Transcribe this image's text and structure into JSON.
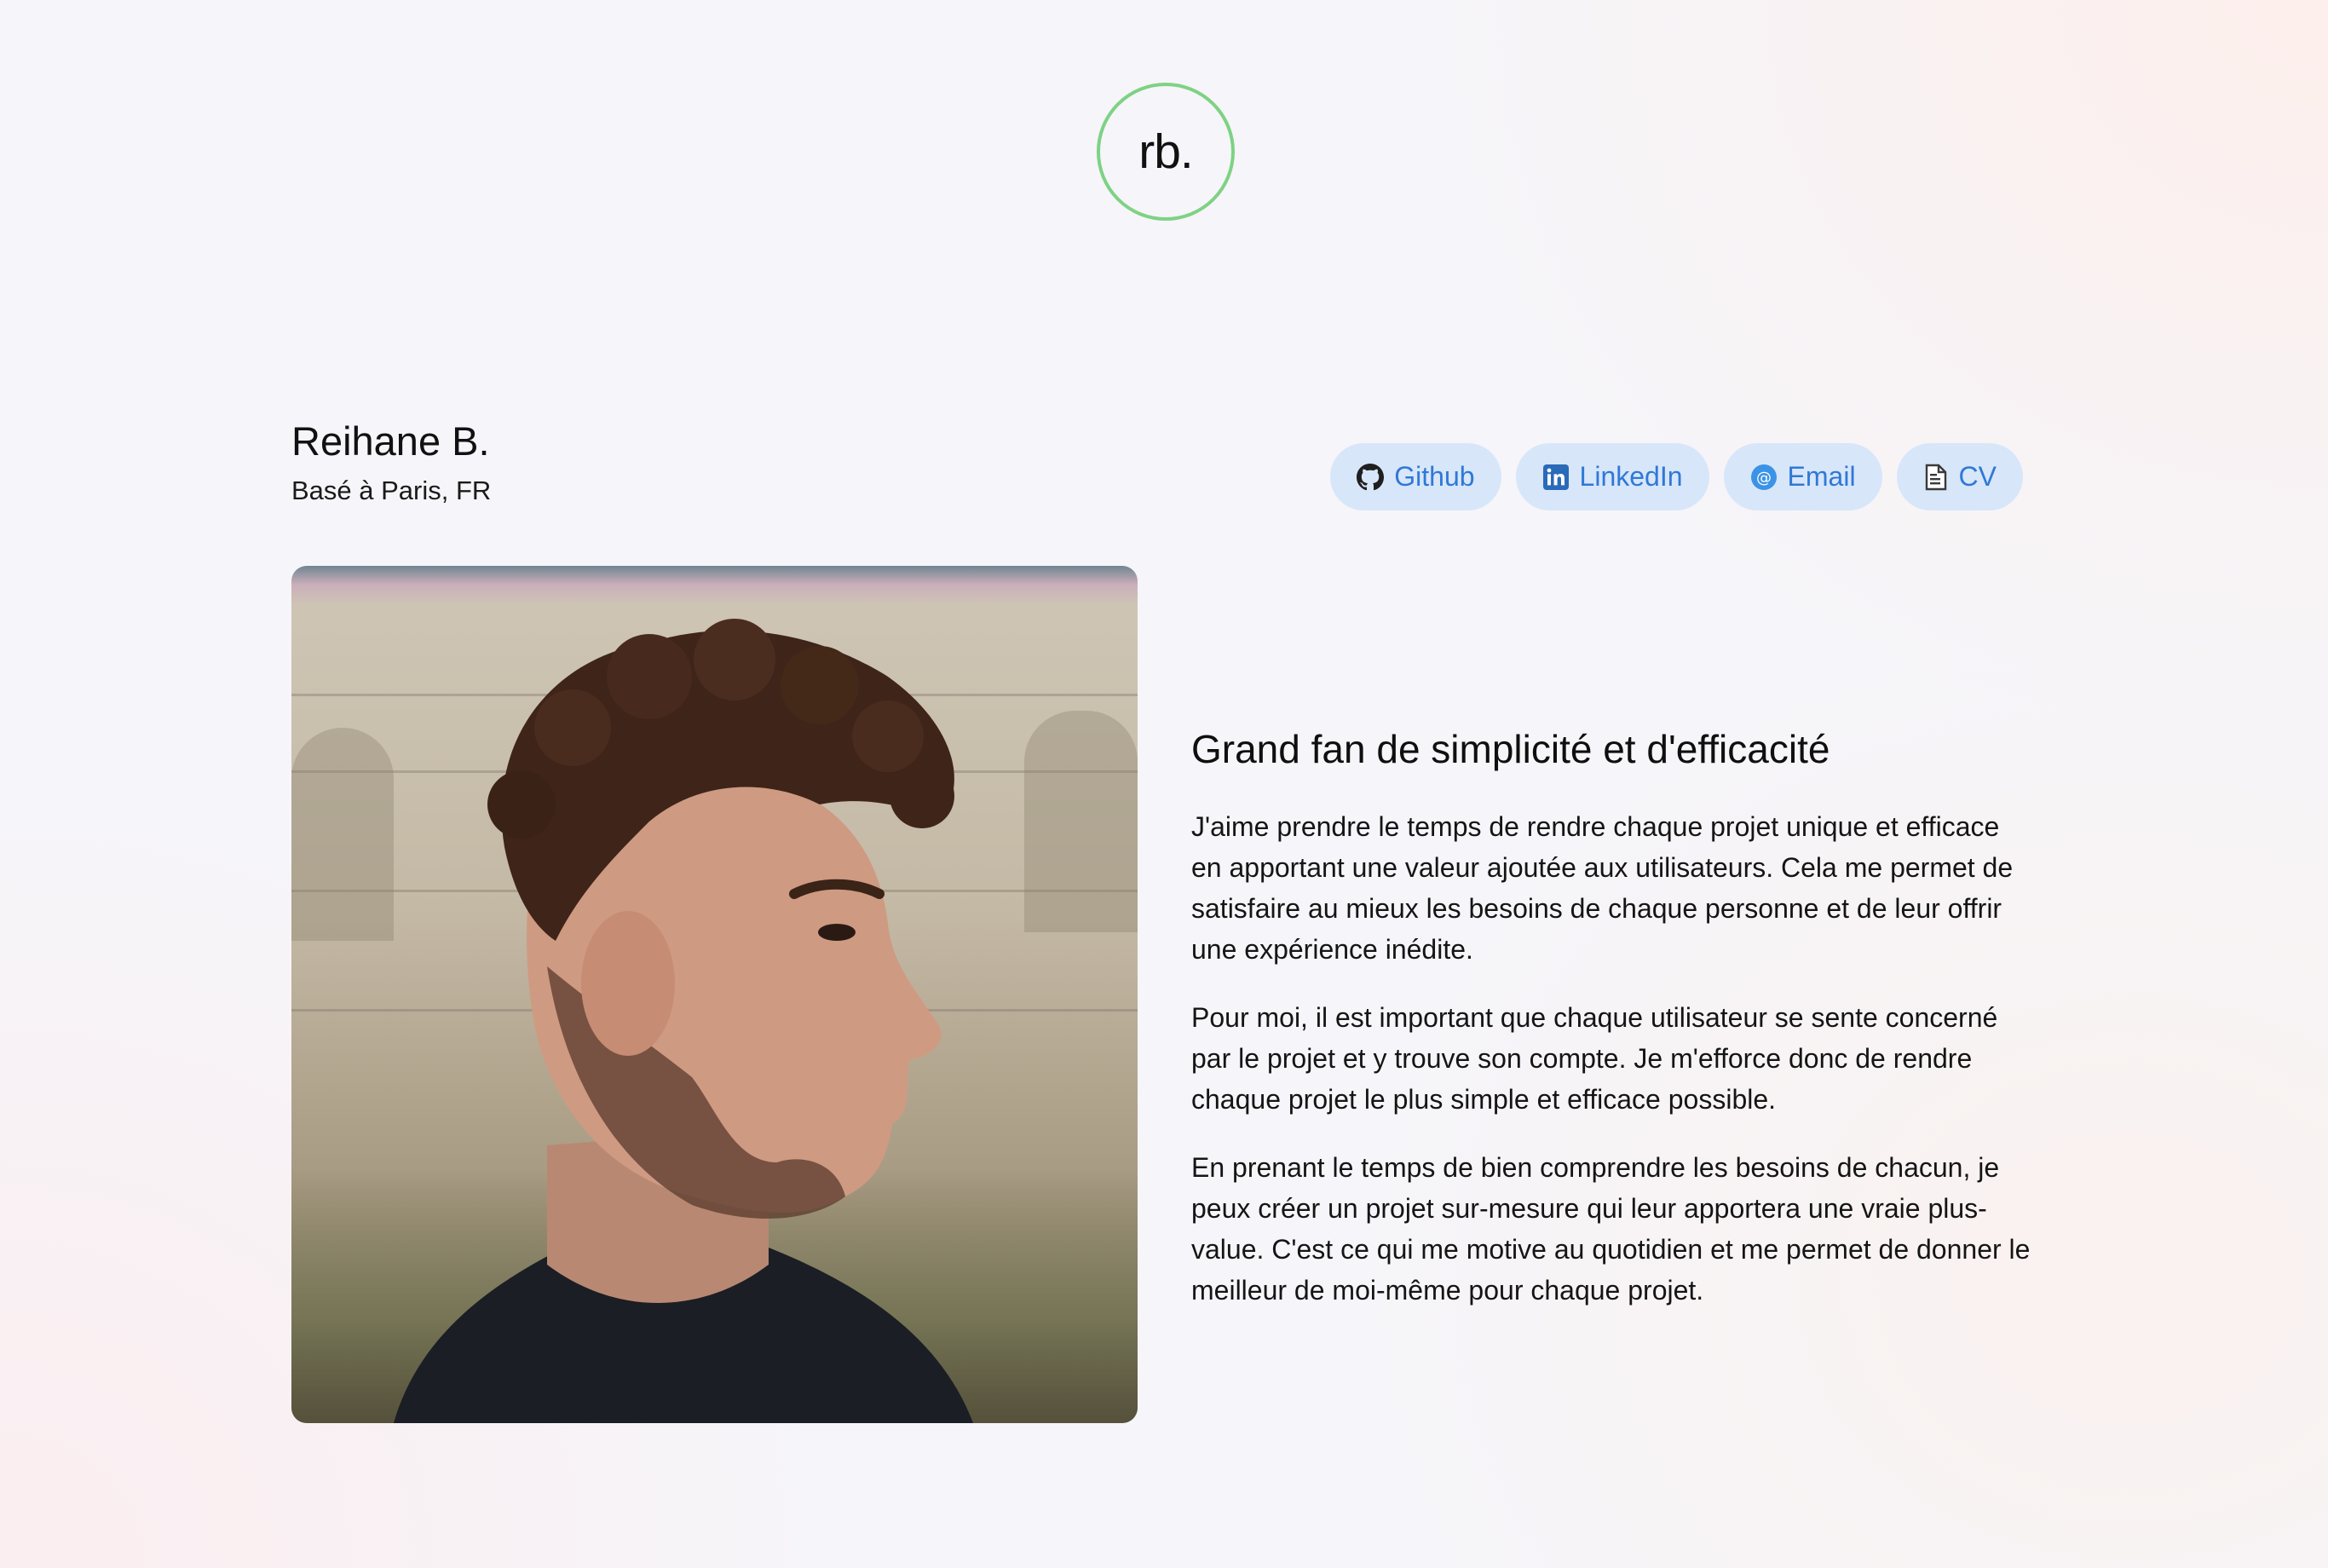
{
  "logo": {
    "text": "rb."
  },
  "profile": {
    "name": "Reihane B.",
    "location": "Basé à Paris, FR"
  },
  "links": [
    {
      "label": "Github",
      "icon": "github-icon"
    },
    {
      "label": "LinkedIn",
      "icon": "linkedin-icon"
    },
    {
      "label": "Email",
      "icon": "at-sign-icon"
    },
    {
      "label": "CV",
      "icon": "document-icon"
    }
  ],
  "about": {
    "headline": "Grand fan de simplicité et d'efficacité",
    "paragraphs": [
      "J'aime prendre le temps de rendre chaque projet unique et efficace en apportant une valeur ajoutée aux utilisateurs. Cela me permet de satisfaire au mieux les besoins de chaque personne et de leur offrir une expérience inédite.",
      "Pour moi, il est important que chaque utilisateur se sente concerné par le projet et y trouve son compte. Je m'efforce donc de rendre chaque projet le plus simple et efficace possible.",
      "En prenant le temps de bien comprendre les besoins de chacun, je peux créer un projet sur-mesure qui leur apportera une vraie plus-value. C'est ce qui me motive au quotidien et me permet de donner le meilleur de moi-même pour chaque projet."
    ]
  },
  "colors": {
    "logo_ring": "#7ed284",
    "link_background": "#d8e6fa",
    "link_text": "#2f79d6"
  }
}
